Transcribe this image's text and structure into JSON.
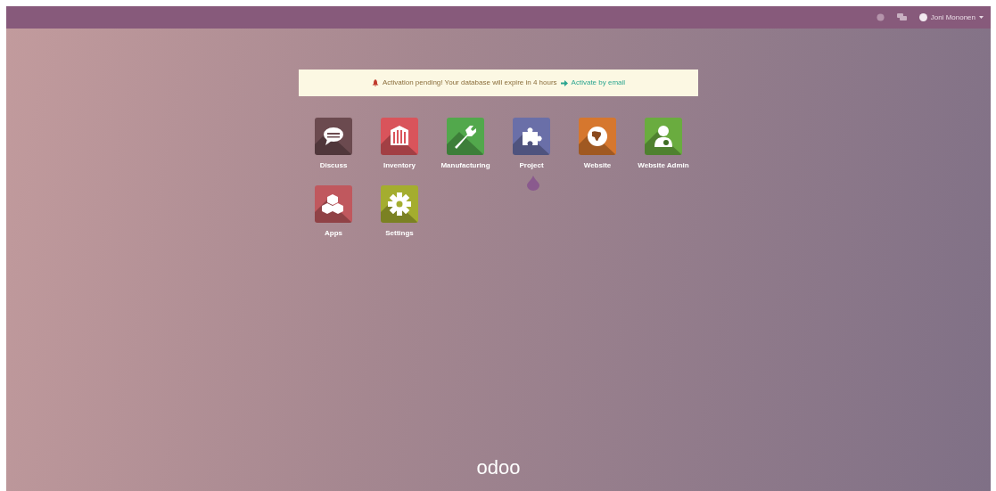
{
  "topbar": {
    "user": {
      "name": "Joni Mononen"
    }
  },
  "notice": {
    "text": "Activation pending! Your database will expire in 4 hours",
    "link": "Activate by email"
  },
  "apps": [
    {
      "label": "Discuss",
      "kind": "chat",
      "color": "#6b4a4f"
    },
    {
      "label": "Inventory",
      "kind": "building",
      "color": "#d9545b"
    },
    {
      "label": "Manufacturing",
      "kind": "wrench",
      "color": "#52a84c"
    },
    {
      "label": "Project",
      "kind": "puzzle",
      "color": "#6a6fa8"
    },
    {
      "label": "Website",
      "kind": "globe",
      "color": "#d6772e"
    },
    {
      "label": "Website Admin",
      "kind": "user",
      "color": "#6aac3f"
    },
    {
      "label": "Apps",
      "kind": "cubes",
      "color": "#c0585e"
    },
    {
      "label": "Settings",
      "kind": "gear",
      "color": "#a4ad2f"
    }
  ],
  "footer": {
    "logo": "odoo"
  }
}
